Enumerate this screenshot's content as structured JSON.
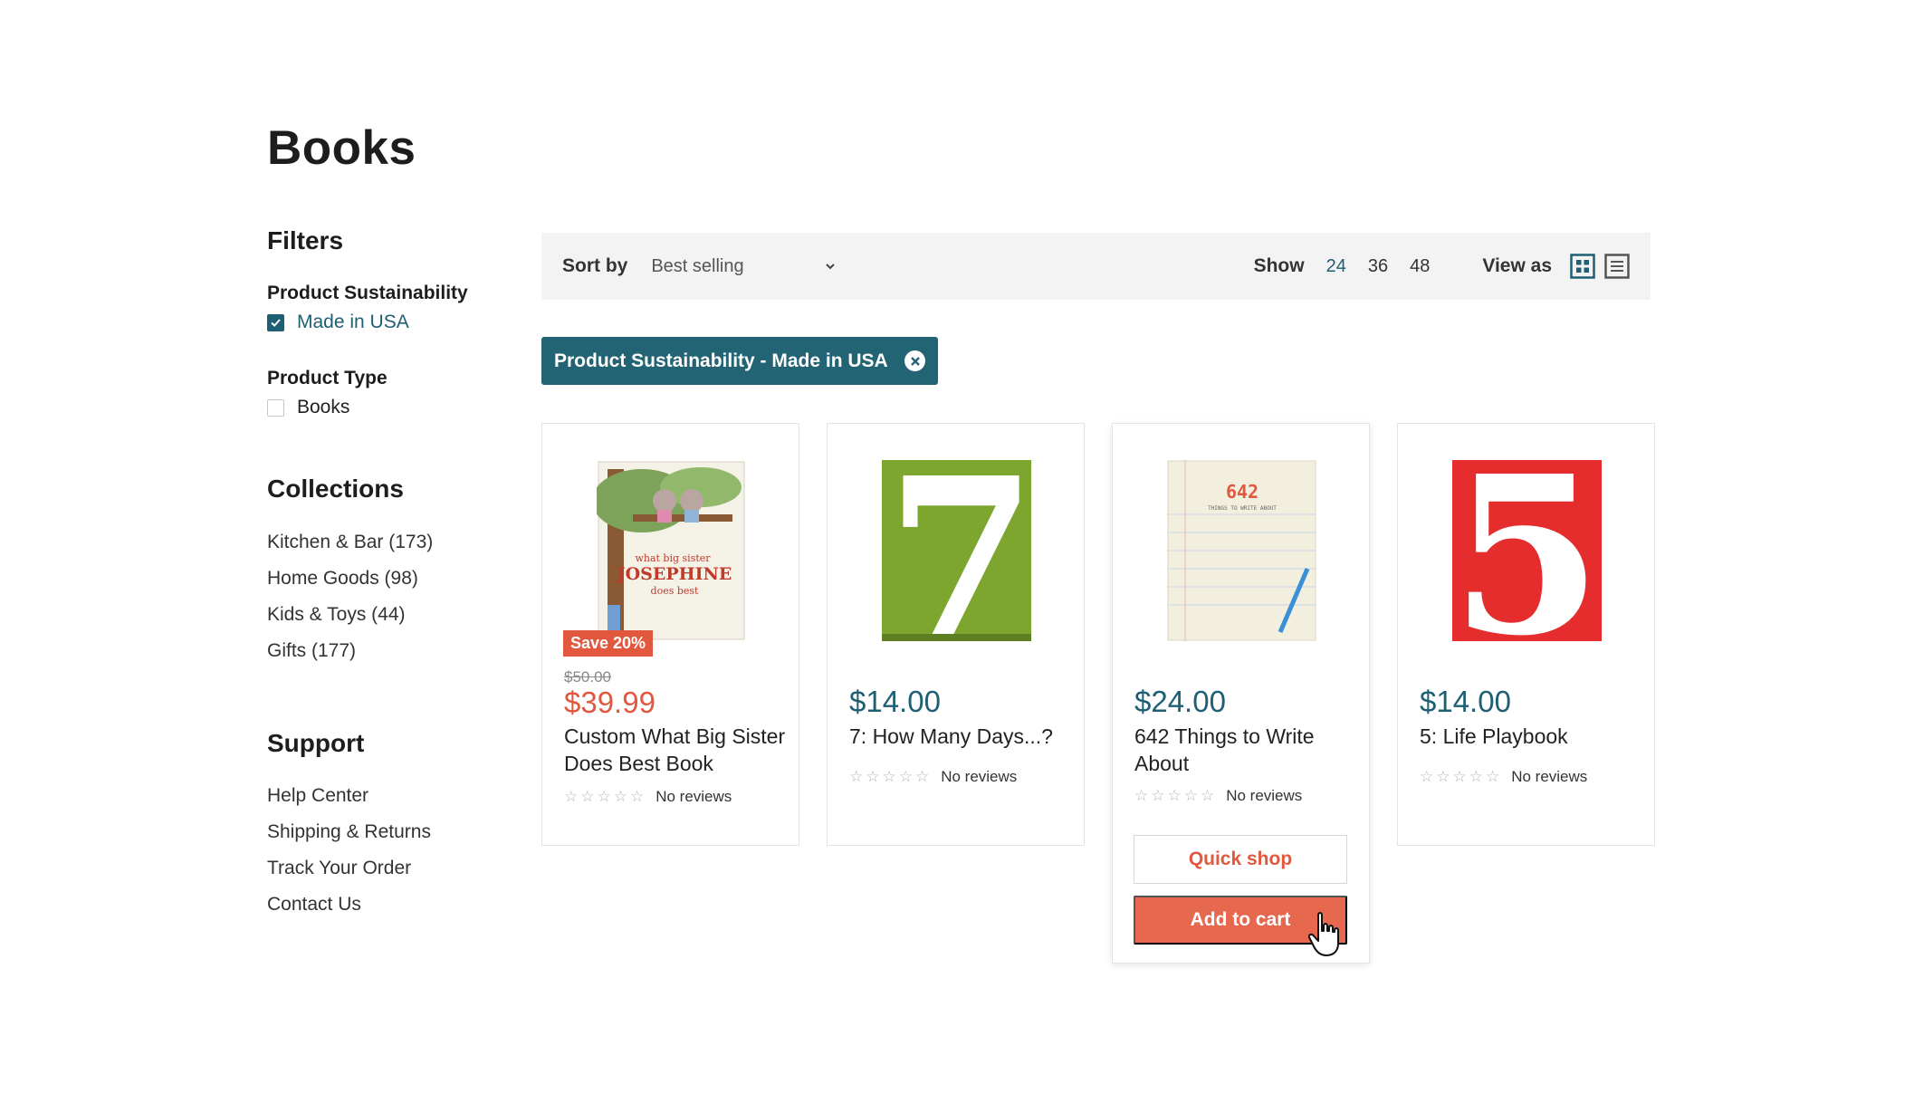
{
  "page": {
    "title": "Books"
  },
  "sidebar": {
    "filters_heading": "Filters",
    "groups": [
      {
        "title": "Product Sustainability",
        "options": [
          {
            "label": "Made in USA",
            "checked": true
          }
        ]
      },
      {
        "title": "Product Type",
        "options": [
          {
            "label": "Books",
            "checked": false
          }
        ]
      }
    ],
    "collections_heading": "Collections",
    "collections": [
      "Kitchen & Bar (173)",
      "Home Goods (98)",
      "Kids & Toys (44)",
      "Gifts (177)"
    ],
    "support_heading": "Support",
    "support_links": [
      "Help Center",
      "Shipping & Returns",
      "Track Your Order",
      "Contact Us"
    ]
  },
  "toolbar": {
    "sort_label": "Sort by",
    "sort_value": "Best selling",
    "show_label": "Show",
    "show_options": [
      "24",
      "36",
      "48"
    ],
    "show_active": "24",
    "view_label": "View as",
    "view_icons": [
      "grid-view-icon",
      "list-view-icon"
    ]
  },
  "active_filter": {
    "label": "Product Sustainability - Made in USA"
  },
  "products": [
    {
      "badge": "Save 20%",
      "compare_price": "$50.00",
      "price": "$39.99",
      "title": "Custom What Big Sister Does Best Book",
      "reviews": "No reviews",
      "cover_title_line1": "what big sister",
      "cover_title_line2": "JOSEPHINE",
      "cover_title_line3": "does best"
    },
    {
      "price": "$14.00",
      "title": "7: How Many Days...?",
      "reviews": "No reviews",
      "cover_glyph": "7"
    },
    {
      "price": "$24.00",
      "title": "642 Things to Write About",
      "reviews": "No reviews",
      "cover_glyph": "642",
      "cover_sub": "THINGS TO WRITE ABOUT",
      "quick_shop": "Quick shop",
      "add_to_cart": "Add to cart"
    },
    {
      "price": "$14.00",
      "title": "5: Life Playbook",
      "reviews": "No reviews",
      "cover_glyph": "5"
    }
  ],
  "colors": {
    "accent": "#1f5f74",
    "sale": "#e2583e",
    "button": "#e5684f",
    "toolbar_bg": "#f3f3f3"
  }
}
